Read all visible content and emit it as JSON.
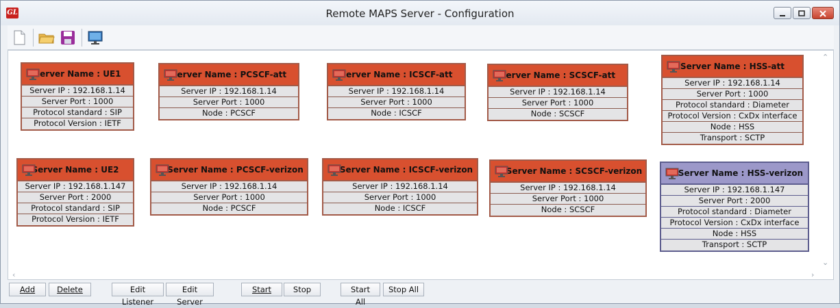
{
  "window": {
    "title": "Remote MAPS Server - Configuration",
    "app_icon_text": "GL"
  },
  "toolbar": {
    "icons": [
      "new-file-icon",
      "open-folder-icon",
      "save-icon",
      "monitor-icon"
    ]
  },
  "nodes": [
    {
      "id": "ue1",
      "header": "Server Name : UE1",
      "rows": [
        "Server IP : 192.168.1.14",
        "Server Port : 1000",
        "Protocol standard : SIP",
        "Protocol Version : IETF"
      ]
    },
    {
      "id": "pcscf-att",
      "header": "Server Name : PCSCF-att",
      "rows": [
        "Server IP : 192.168.1.14",
        "Server Port : 1000",
        "Node : PCSCF"
      ]
    },
    {
      "id": "icscf-att",
      "header": "Server Name : ICSCF-att",
      "rows": [
        "Server IP : 192.168.1.14",
        "Server Port : 1000",
        "Node : ICSCF"
      ]
    },
    {
      "id": "scscf-att",
      "header": "Server Name : SCSCF-att",
      "rows": [
        "Server IP : 192.168.1.14",
        "Server Port : 1000",
        "Node : SCSCF"
      ]
    },
    {
      "id": "hss-att",
      "header": "Server Name : HSS-att",
      "rows": [
        "Server IP : 192.168.1.14",
        "Server Port : 1000",
        "Protocol standard : Diameter",
        "Protocol Version : CxDx interface",
        "Node : HSS",
        "Transport : SCTP"
      ]
    },
    {
      "id": "ue2",
      "header": "Server Name : UE2",
      "rows": [
        "Server IP : 192.168.1.147",
        "Server Port : 2000",
        "Protocol standard : SIP",
        "Protocol Version : IETF"
      ]
    },
    {
      "id": "pcscf-verizon",
      "header": "Server Name : PCSCF-verizon",
      "rows": [
        "Server IP : 192.168.1.14",
        "Server Port : 1000",
        "Node : PCSCF"
      ]
    },
    {
      "id": "icscf-verizon",
      "header": "Server Name : ICSCF-verizon",
      "rows": [
        "Server IP : 192.168.1.14",
        "Server Port : 1000",
        "Node : ICSCF"
      ]
    },
    {
      "id": "scscf-verizon",
      "header": "Server Name : SCSCF-verizon",
      "rows": [
        "Server IP : 192.168.1.14",
        "Server Port : 1000",
        "Node : SCSCF"
      ]
    },
    {
      "id": "hss-verizon",
      "header": "Server Name : HSS-verizon",
      "selected": true,
      "rows": [
        "Server IP : 192.168.1.147",
        "Server Port : 2000",
        "Protocol standard : Diameter",
        "Protocol Version : CxDx interface",
        "Node : HSS",
        "Transport : SCTP"
      ]
    }
  ],
  "buttons": {
    "add": "Add",
    "delete": "Delete",
    "edit_listener": "Edit Listener",
    "edit_server": "Edit Server",
    "start": "Start",
    "stop": "Stop",
    "start_all": "Start All",
    "stop_all": "Stop All"
  },
  "colors": {
    "node_header": "#d8502f",
    "node_header_selected": "#9c98c9",
    "node_row": "#e4e4e6"
  }
}
